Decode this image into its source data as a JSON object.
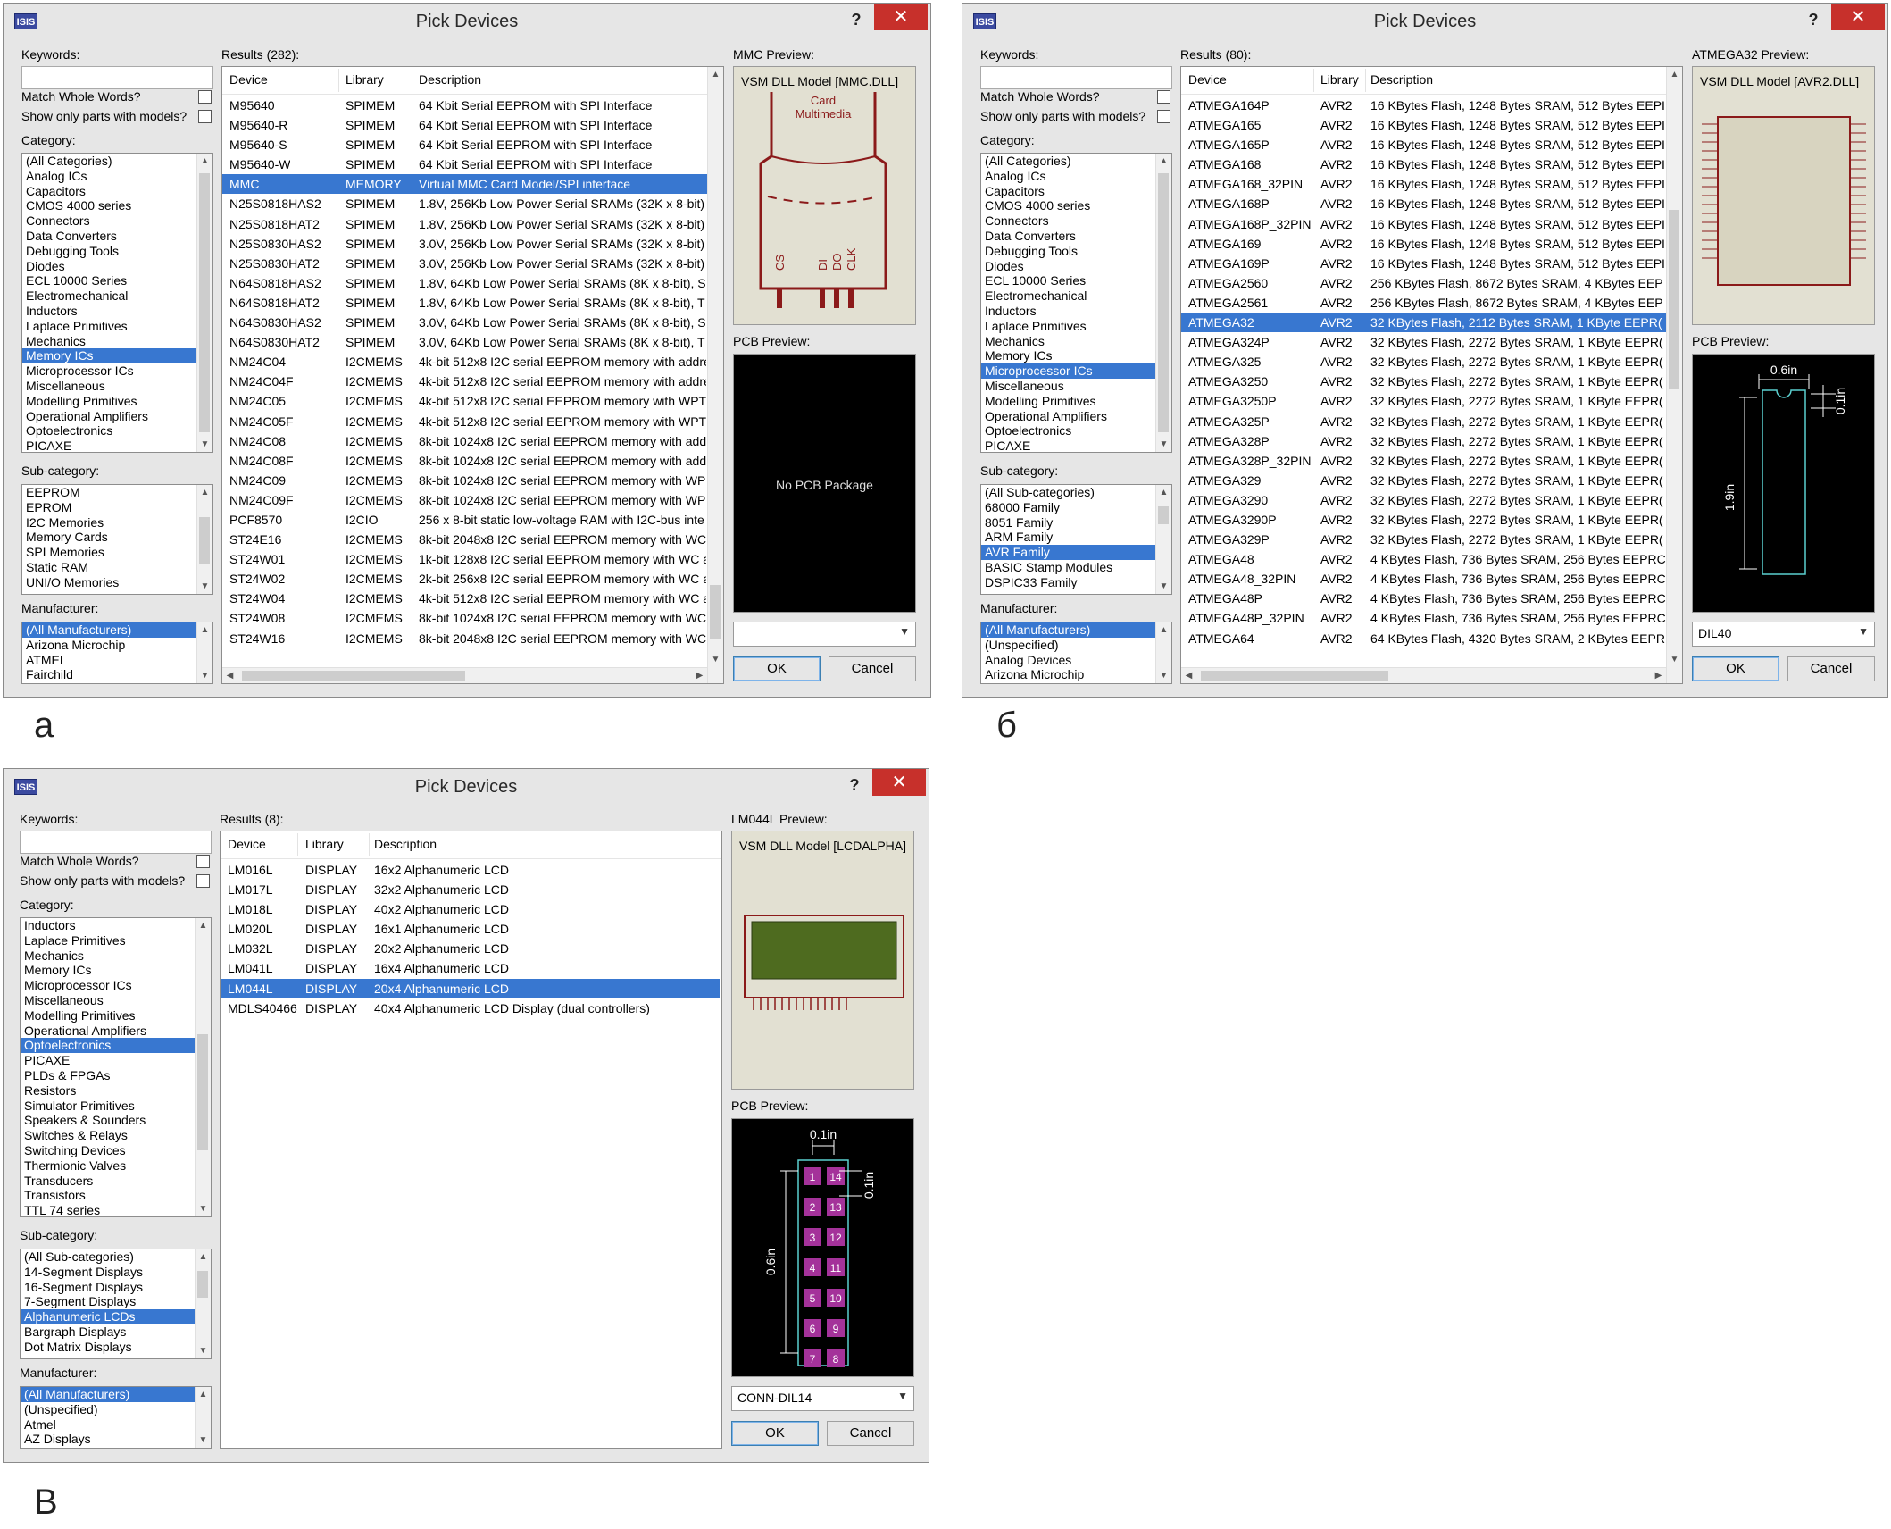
{
  "captions": {
    "a": "а",
    "b": "б",
    "c": "В"
  },
  "common": {
    "title": "Pick Devices",
    "help": "?",
    "close": "✕",
    "app_icon": "ISIS",
    "keywords_label": "Keywords:",
    "match_whole_words": "Match Whole Words?",
    "show_only_models": "Show only parts with models?",
    "category_label": "Category:",
    "subcategory_label": "Sub-category:",
    "manufacturer_label": "Manufacturer:",
    "pcb_preview_label": "PCB Preview:",
    "ok": "OK",
    "cancel": "Cancel",
    "col_device": "Device",
    "col_library": "Library",
    "col_description": "Description",
    "selection_color": "#3877d0",
    "close_color": "#c7302b"
  },
  "dialog_a": {
    "results_label": "Results (282):",
    "preview_label": "MMC Preview:",
    "preview_model": "VSM DLL Model [MMC.DLL]",
    "symbol_text1": "Card",
    "symbol_text2": "Multimedia",
    "symbol_pins": [
      "CS",
      "DI",
      "DO",
      "CLK"
    ],
    "pcb_text": "No PCB Package",
    "package": "",
    "categories": [
      "(All Categories)",
      "Analog ICs",
      "Capacitors",
      "CMOS 4000 series",
      "Connectors",
      "Data Converters",
      "Debugging Tools",
      "Diodes",
      "ECL 10000 Series",
      "Electromechanical",
      "Inductors",
      "Laplace Primitives",
      "Mechanics",
      "Memory ICs",
      "Microprocessor ICs",
      "Miscellaneous",
      "Modelling Primitives",
      "Operational Amplifiers",
      "Optoelectronics",
      "PICAXE"
    ],
    "subcategories": [
      "EEPROM",
      "EPROM",
      "I2C Memories",
      "Memory Cards",
      "SPI Memories",
      "Static RAM",
      "UNI/O Memories"
    ],
    "manufacturers": [
      "(All Manufacturers)",
      "Arizona Microchip",
      "ATMEL",
      "Fairchild"
    ],
    "rows": [
      [
        "M95640",
        "SPIMEM",
        "64 Kbit Serial EEPROM with SPI Interface"
      ],
      [
        "M95640-R",
        "SPIMEM",
        "64 Kbit Serial EEPROM with SPI Interface"
      ],
      [
        "M95640-S",
        "SPIMEM",
        "64 Kbit Serial EEPROM with SPI Interface"
      ],
      [
        "M95640-W",
        "SPIMEM",
        "64 Kbit Serial EEPROM with SPI Interface"
      ],
      [
        "MMC",
        "MEMORY",
        "Virtual MMC Card Model/SPI interface"
      ],
      [
        "N25S0818HAS2",
        "SPIMEM",
        "1.8V, 256Kb Low Power Serial SRAMs (32K x 8-bit)"
      ],
      [
        "N25S0818HAT2",
        "SPIMEM",
        "1.8V, 256Kb Low Power Serial SRAMs (32K x 8-bit)"
      ],
      [
        "N25S0830HAS2",
        "SPIMEM",
        "3.0V, 256Kb Low Power Serial SRAMs (32K x 8-bit)"
      ],
      [
        "N25S0830HAT2",
        "SPIMEM",
        "3.0V, 256Kb Low Power Serial SRAMs (32K x 8-bit)"
      ],
      [
        "N64S0818HAS2",
        "SPIMEM",
        "1.8V, 64Kb Low Power Serial SRAMs (8K x 8-bit), S"
      ],
      [
        "N64S0818HAT2",
        "SPIMEM",
        "1.8V, 64Kb Low Power Serial SRAMs (8K x 8-bit), T"
      ],
      [
        "N64S0830HAS2",
        "SPIMEM",
        "3.0V, 64Kb Low Power Serial SRAMs (8K x 8-bit), S"
      ],
      [
        "N64S0830HAT2",
        "SPIMEM",
        "3.0V, 64Kb Low Power Serial SRAMs (8K x 8-bit), T"
      ],
      [
        "NM24C04",
        "I2CMEMS",
        "4k-bit 512x8 I2C serial EEPROM memory with addre"
      ],
      [
        "NM24C04F",
        "I2CMEMS",
        "4k-bit 512x8 I2C serial EEPROM memory with addre"
      ],
      [
        "NM24C05",
        "I2CMEMS",
        "4k-bit 512x8 I2C serial EEPROM memory with WPT"
      ],
      [
        "NM24C05F",
        "I2CMEMS",
        "4k-bit 512x8 I2C serial EEPROM memory with WPT"
      ],
      [
        "NM24C08",
        "I2CMEMS",
        "8k-bit 1024x8 I2C serial EEPROM memory with add"
      ],
      [
        "NM24C08F",
        "I2CMEMS",
        "8k-bit 1024x8 I2C serial EEPROM memory with add"
      ],
      [
        "NM24C09",
        "I2CMEMS",
        "8k-bit 1024x8 I2C serial EEPROM memory with WP"
      ],
      [
        "NM24C09F",
        "I2CMEMS",
        "8k-bit 1024x8 I2C serial EEPROM memory with WP"
      ],
      [
        "PCF8570",
        "I2CIO",
        "256 x 8-bit static low-voltage RAM with I2C-bus inte"
      ],
      [
        "ST24E16",
        "I2CMEMS",
        "8k-bit 2048x8 I2C serial EEPROM memory with WC"
      ],
      [
        "ST24W01",
        "I2CMEMS",
        "1k-bit 128x8 I2C serial EEPROM memory with WC a"
      ],
      [
        "ST24W02",
        "I2CMEMS",
        "2k-bit 256x8 I2C serial EEPROM memory with WC a"
      ],
      [
        "ST24W04",
        "I2CMEMS",
        "4k-bit 512x8 I2C serial EEPROM memory with WC a"
      ],
      [
        "ST24W08",
        "I2CMEMS",
        "8k-bit 1024x8 I2C serial EEPROM memory with WC"
      ],
      [
        "ST24W16",
        "I2CMEMS",
        "8k-bit 2048x8 I2C serial EEPROM memory with WC"
      ]
    ]
  },
  "dialog_b": {
    "results_label": "Results (80):",
    "preview_label": "ATMEGA32 Preview:",
    "preview_model": "VSM DLL Model [AVR2.DLL]",
    "dim_w": "0.6in",
    "dim_h": "1.9in",
    "dim_p": "0.1in",
    "package": "DIL40",
    "categories": [
      "(All Categories)",
      "Analog ICs",
      "Capacitors",
      "CMOS 4000 series",
      "Connectors",
      "Data Converters",
      "Debugging Tools",
      "Diodes",
      "ECL 10000 Series",
      "Electromechanical",
      "Inductors",
      "Laplace Primitives",
      "Mechanics",
      "Memory ICs",
      "Microprocessor ICs",
      "Miscellaneous",
      "Modelling Primitives",
      "Operational Amplifiers",
      "Optoelectronics",
      "PICAXE"
    ],
    "subcategories": [
      "(All Sub-categories)",
      "68000 Family",
      "8051 Family",
      "ARM Family",
      "AVR Family",
      "BASIC Stamp Modules",
      "DSPIC33 Family"
    ],
    "manufacturers": [
      "(All Manufacturers)",
      "(Unspecified)",
      "Analog Devices",
      "Arizona Microchip"
    ],
    "rows": [
      [
        "ATMEGA164P",
        "AVR2",
        "16 KBytes Flash, 1248 Bytes SRAM, 512 Bytes EEPI"
      ],
      [
        "ATMEGA165",
        "AVR2",
        "16 KBytes Flash, 1248 Bytes SRAM, 512 Bytes EEPI"
      ],
      [
        "ATMEGA165P",
        "AVR2",
        "16 KBytes Flash, 1248 Bytes SRAM, 512 Bytes EEPI"
      ],
      [
        "ATMEGA168",
        "AVR2",
        "16 KBytes Flash, 1248 Bytes SRAM, 512 Bytes EEPI"
      ],
      [
        "ATMEGA168_32PIN",
        "AVR2",
        "16 KBytes Flash, 1248 Bytes SRAM, 512 Bytes EEPI"
      ],
      [
        "ATMEGA168P",
        "AVR2",
        "16 KBytes Flash, 1248 Bytes SRAM, 512 Bytes EEPI"
      ],
      [
        "ATMEGA168P_32PIN",
        "AVR2",
        "16 KBytes Flash, 1248 Bytes SRAM, 512 Bytes EEPI"
      ],
      [
        "ATMEGA169",
        "AVR2",
        "16 KBytes Flash, 1248 Bytes SRAM, 512 Bytes EEPI"
      ],
      [
        "ATMEGA169P",
        "AVR2",
        "16 KBytes Flash, 1248 Bytes SRAM, 512 Bytes EEPI"
      ],
      [
        "ATMEGA2560",
        "AVR2",
        "256 KBytes Flash, 8672 Bytes SRAM, 4 KBytes EEP"
      ],
      [
        "ATMEGA2561",
        "AVR2",
        "256 KBytes Flash, 8672 Bytes SRAM, 4 KBytes EEP"
      ],
      [
        "ATMEGA32",
        "AVR2",
        "32 KBytes Flash, 2112 Bytes SRAM, 1 KByte EEPR("
      ],
      [
        "ATMEGA324P",
        "AVR2",
        "32 KBytes Flash, 2272 Bytes SRAM, 1 KByte EEPR("
      ],
      [
        "ATMEGA325",
        "AVR2",
        "32 KBytes Flash, 2272 Bytes SRAM, 1 KByte EEPR("
      ],
      [
        "ATMEGA3250",
        "AVR2",
        "32 KBytes Flash, 2272 Bytes SRAM, 1 KByte EEPR("
      ],
      [
        "ATMEGA3250P",
        "AVR2",
        "32 KBytes Flash, 2272 Bytes SRAM, 1 KByte EEPR("
      ],
      [
        "ATMEGA325P",
        "AVR2",
        "32 KBytes Flash, 2272 Bytes SRAM, 1 KByte EEPR("
      ],
      [
        "ATMEGA328P",
        "AVR2",
        "32 KBytes Flash, 2272 Bytes SRAM, 1 KByte EEPR("
      ],
      [
        "ATMEGA328P_32PIN",
        "AVR2",
        "32 KBytes Flash, 2272 Bytes SRAM, 1 KByte EEPR("
      ],
      [
        "ATMEGA329",
        "AVR2",
        "32 KBytes Flash, 2272 Bytes SRAM, 1 KByte EEPR("
      ],
      [
        "ATMEGA3290",
        "AVR2",
        "32 KBytes Flash, 2272 Bytes SRAM, 1 KByte EEPR("
      ],
      [
        "ATMEGA3290P",
        "AVR2",
        "32 KBytes Flash, 2272 Bytes SRAM, 1 KByte EEPR("
      ],
      [
        "ATMEGA329P",
        "AVR2",
        "32 KBytes Flash, 2272 Bytes SRAM, 1 KByte EEPR("
      ],
      [
        "ATMEGA48",
        "AVR2",
        "4 KBytes Flash, 736 Bytes SRAM, 256 Bytes EEPRC"
      ],
      [
        "ATMEGA48_32PIN",
        "AVR2",
        "4 KBytes Flash, 736 Bytes SRAM, 256 Bytes EEPRC"
      ],
      [
        "ATMEGA48P",
        "AVR2",
        "4 KBytes Flash, 736 Bytes SRAM, 256 Bytes EEPRC"
      ],
      [
        "ATMEGA48P_32PIN",
        "AVR2",
        "4 KBytes Flash, 736 Bytes SRAM, 256 Bytes EEPRC"
      ],
      [
        "ATMEGA64",
        "AVR2",
        "64 KBytes Flash, 4320 Bytes SRAM, 2 KBytes EEPR"
      ]
    ]
  },
  "dialog_c": {
    "results_label": "Results (8):",
    "preview_label": "LM044L Preview:",
    "preview_model": "VSM DLL Model [LCDALPHA]",
    "dim_top": "0.1in",
    "dim_side": "0.1in",
    "dim_h": "0.6in",
    "pads_left": [
      "1",
      "2",
      "3",
      "4",
      "5",
      "6",
      "7"
    ],
    "pads_right": [
      "14",
      "13",
      "12",
      "11",
      "10",
      "9",
      "8"
    ],
    "package": "CONN-DIL14",
    "categories": [
      "Inductors",
      "Laplace Primitives",
      "Mechanics",
      "Memory ICs",
      "Microprocessor ICs",
      "Miscellaneous",
      "Modelling Primitives",
      "Operational Amplifiers",
      "Optoelectronics",
      "PICAXE",
      "PLDs & FPGAs",
      "Resistors",
      "Simulator Primitives",
      "Speakers & Sounders",
      "Switches & Relays",
      "Switching Devices",
      "Thermionic Valves",
      "Transducers",
      "Transistors",
      "TTL 74 series"
    ],
    "subcategories": [
      "(All Sub-categories)",
      "14-Segment Displays",
      "16-Segment Displays",
      "7-Segment Displays",
      "Alphanumeric LCDs",
      "Bargraph Displays",
      "Dot Matrix Displays"
    ],
    "manufacturers": [
      "(All Manufacturers)",
      "(Unspecified)",
      "Atmel",
      "AZ Displays"
    ],
    "rows": [
      [
        "LM016L",
        "DISPLAY",
        "16x2 Alphanumeric LCD"
      ],
      [
        "LM017L",
        "DISPLAY",
        "32x2 Alphanumeric LCD"
      ],
      [
        "LM018L",
        "DISPLAY",
        "40x2 Alphanumeric LCD"
      ],
      [
        "LM020L",
        "DISPLAY",
        "16x1 Alphanumeric LCD"
      ],
      [
        "LM032L",
        "DISPLAY",
        "20x2 Alphanumeric LCD"
      ],
      [
        "LM041L",
        "DISPLAY",
        "16x4 Alphanumeric LCD"
      ],
      [
        "LM044L",
        "DISPLAY",
        "20x4 Alphanumeric LCD"
      ],
      [
        "MDLS40466",
        "DISPLAY",
        "40x4 Alphanumeric LCD Display (dual controllers)"
      ]
    ]
  }
}
